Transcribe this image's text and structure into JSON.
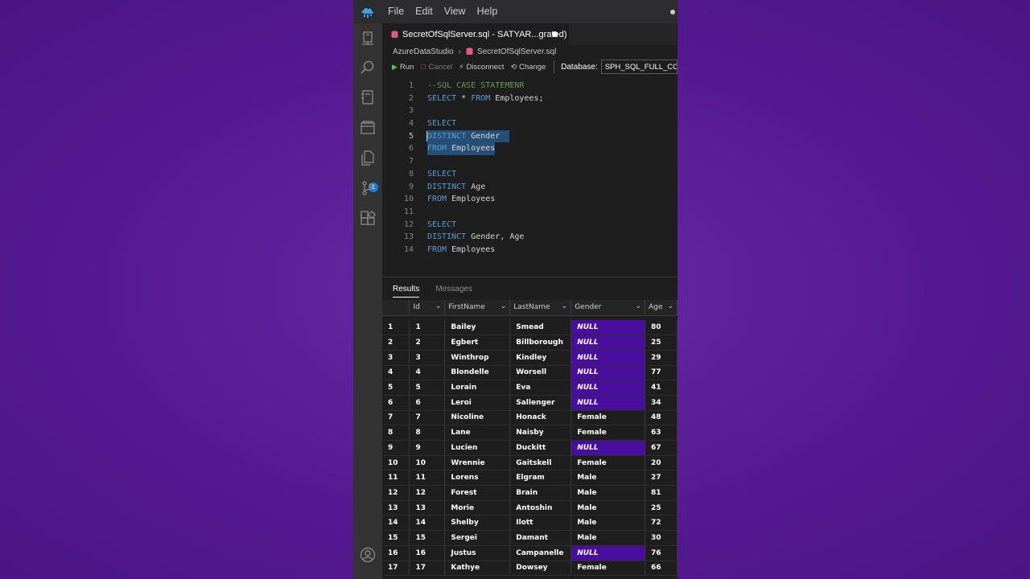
{
  "menu": {
    "items": [
      "File",
      "Edit",
      "View",
      "Help"
    ]
  },
  "tab": {
    "title": "SecretOfSqlServer.sql - SATYAR...grated)"
  },
  "breadcrumb": {
    "root": "AzureDataStudio",
    "file": "SecretOfSqlServer.sql"
  },
  "toolbar": {
    "run": "Run",
    "cancel": "Cancel",
    "disconnect": "Disconnect",
    "change": "Change",
    "database_label": "Database:",
    "database_value": "SPH_SQL_FULL_COURSE..."
  },
  "code_lines": [
    "--SQL CASE STATEMENR",
    "SELECT * FROM Employees;",
    "",
    "SELECT",
    "DISTINCT Gender",
    "FROM Employees",
    "",
    "SELECT",
    "DISTINCT Age",
    "FROM Employees",
    "",
    "SELECT",
    "DISTINCT Gender, Age",
    "FROM Employees"
  ],
  "line_numbers": [
    "1",
    "2",
    "3",
    "4",
    "5",
    "6",
    "7",
    "8",
    "9",
    "10",
    "11",
    "12",
    "13",
    "14"
  ],
  "results": {
    "tabs": [
      "Results",
      "Messages"
    ],
    "columns": [
      "Id",
      "FirstName",
      "LastName",
      "Gender",
      "Age"
    ],
    "rows": [
      [
        "1",
        "1",
        "Bailey",
        "Smead",
        "NULL",
        "80"
      ],
      [
        "2",
        "2",
        "Egbert",
        "Billborough",
        "NULL",
        "25"
      ],
      [
        "3",
        "3",
        "Winthrop",
        "Kindley",
        "NULL",
        "29"
      ],
      [
        "4",
        "4",
        "Blondelle",
        "Worsell",
        "NULL",
        "77"
      ],
      [
        "5",
        "5",
        "Lorain",
        "Eva",
        "NULL",
        "41"
      ],
      [
        "6",
        "6",
        "Leroi",
        "Sallenger",
        "NULL",
        "34"
      ],
      [
        "7",
        "7",
        "Nicoline",
        "Honack",
        "Female",
        "48"
      ],
      [
        "8",
        "8",
        "Lane",
        "Naisby",
        "Female",
        "63"
      ],
      [
        "9",
        "9",
        "Lucien",
        "Duckitt",
        "NULL",
        "67"
      ],
      [
        "10",
        "10",
        "Wrennie",
        "Gaitskell",
        "Female",
        "20"
      ],
      [
        "11",
        "11",
        "Lorens",
        "Elgram",
        "Male",
        "27"
      ],
      [
        "12",
        "12",
        "Forest",
        "Brain",
        "Male",
        "81"
      ],
      [
        "13",
        "13",
        "Morie",
        "Antoshin",
        "Male",
        "25"
      ],
      [
        "14",
        "14",
        "Shelby",
        "Ilott",
        "Male",
        "72"
      ],
      [
        "15",
        "15",
        "Sergei",
        "Damant",
        "Male",
        "30"
      ],
      [
        "16",
        "16",
        "Justus",
        "Campanelle",
        "NULL",
        "76"
      ],
      [
        "17",
        "17",
        "Kathye",
        "Dowsey",
        "Female",
        "66"
      ]
    ]
  },
  "badge_count": "1",
  "colors": {
    "background": "#5a1f96",
    "editor": "#1e1e1e",
    "null_cell": "#4a0e9e",
    "keyword": "#569cd6",
    "comment": "#6a9955"
  }
}
